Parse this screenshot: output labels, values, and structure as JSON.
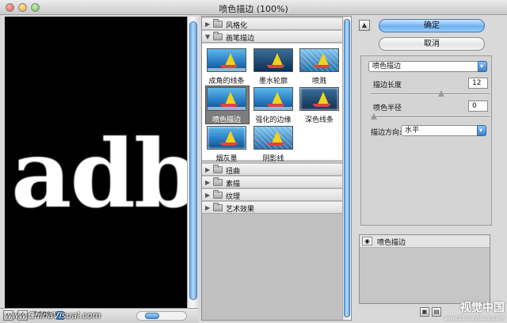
{
  "window": {
    "title": "喷色描边 (100%)"
  },
  "preview": {
    "sample_text": "adb"
  },
  "status": {
    "zoom": "100%",
    "watermark": "www.ChinaVisual.com"
  },
  "gallery": {
    "categories_top": [
      {
        "label": "风格化",
        "expanded": false
      },
      {
        "label": "画笔描边",
        "expanded": true
      }
    ],
    "thumbnails": [
      {
        "label": "成角的线条",
        "selected": false
      },
      {
        "label": "墨水轮廓",
        "selected": false
      },
      {
        "label": "喷溅",
        "selected": false
      },
      {
        "label": "喷色描边",
        "selected": true
      },
      {
        "label": "强化的边缘",
        "selected": false
      },
      {
        "label": "深色线条",
        "selected": false
      },
      {
        "label": "烟灰墨",
        "selected": false
      },
      {
        "label": "阴影线",
        "selected": false
      }
    ],
    "categories_bottom": [
      {
        "label": "扭曲"
      },
      {
        "label": "素描"
      },
      {
        "label": "纹理"
      },
      {
        "label": "艺术效果"
      }
    ]
  },
  "actions": {
    "ok_label": "确定",
    "cancel_label": "取消"
  },
  "settings": {
    "filter_select": "喷色描边",
    "stroke_length": {
      "label": "描边长度",
      "value": "12",
      "fraction": 0.6
    },
    "spray_radius": {
      "label": "喷色半径",
      "value": "0",
      "fraction": 0.0
    },
    "stroke_direction": {
      "label": "描边方向:",
      "value": "水平"
    }
  },
  "layers": {
    "items": [
      {
        "name": "喷色描边"
      }
    ]
  },
  "brand": {
    "name": "视觉中国",
    "url": "www.ChinaVisual.com"
  }
}
